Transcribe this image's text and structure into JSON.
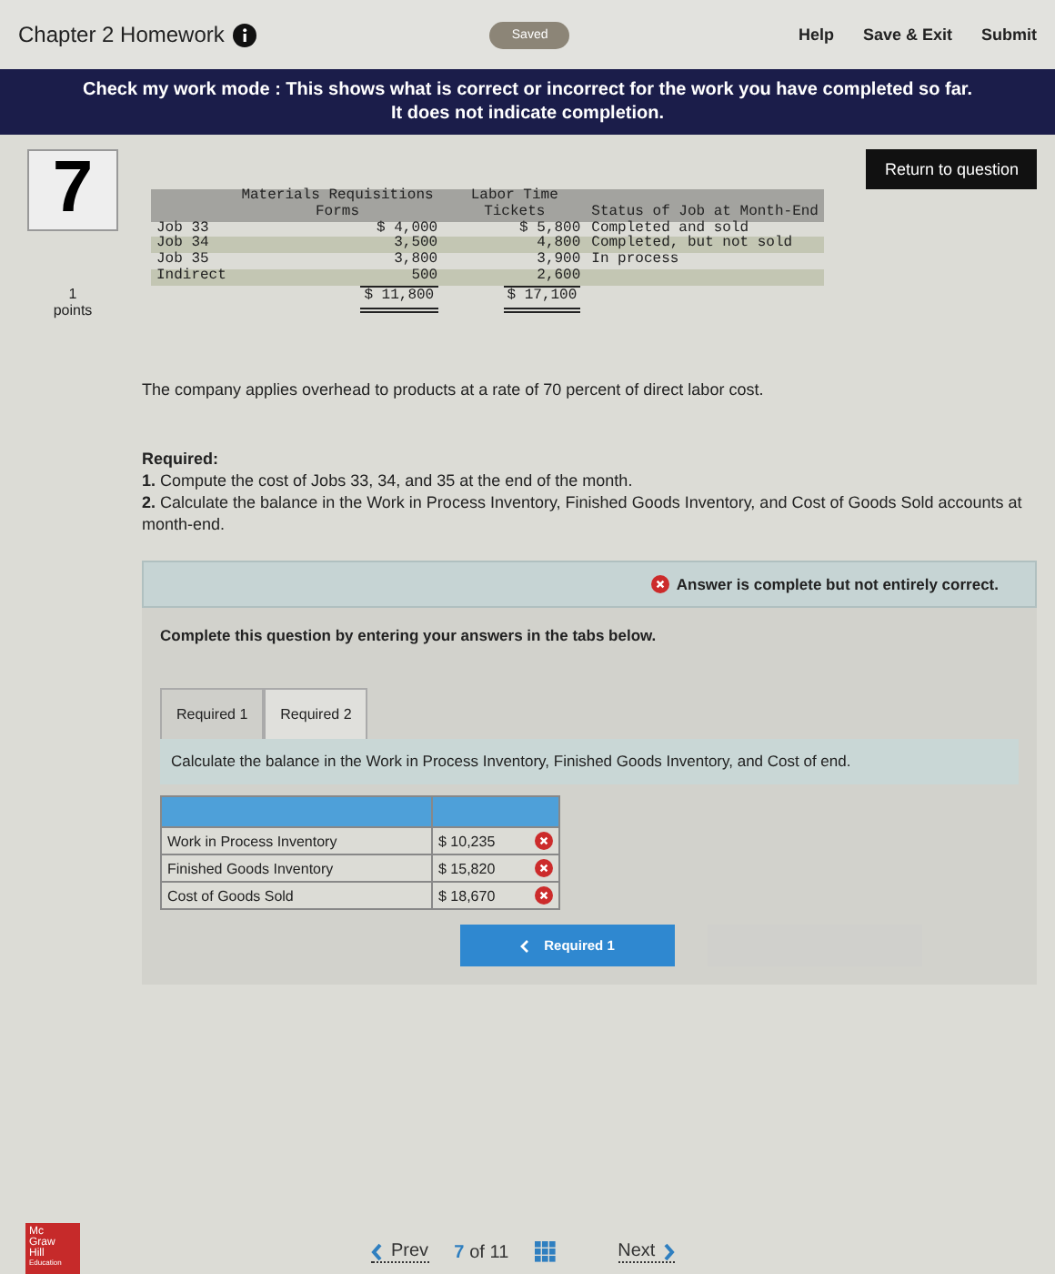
{
  "header": {
    "title": "Chapter 2 Homework",
    "saved_badge": "Saved",
    "links": [
      "Help",
      "Save & Exit",
      "Submit"
    ]
  },
  "banner": {
    "lines": [
      "Check my work mode : This shows what is correct or incorrect for the work you have completed so far.",
      "It does not indicate completion."
    ]
  },
  "return_button": "Return to question",
  "question": {
    "number": "7",
    "points_value": "1",
    "points_label": "points"
  },
  "data_table": {
    "columns": [
      "Materials Requisitions Forms",
      "Labor Time Tickets",
      "Status of Job at Month-End"
    ],
    "rows": [
      {
        "label": "Job 33",
        "materials": "$ 4,000",
        "labor": "$ 5,800",
        "status": "Completed and sold"
      },
      {
        "label": "Job 34",
        "materials": "3,500",
        "labor": "4,800",
        "status": "Completed, but not sold"
      },
      {
        "label": "Job 35",
        "materials": "3,800",
        "labor": "3,900",
        "status": "In process"
      },
      {
        "label": "Indirect",
        "materials": "500",
        "labor": "2,600",
        "status": ""
      }
    ],
    "totals": {
      "materials": "$ 11,800",
      "labor": "$ 17,100"
    }
  },
  "overhead_text": "The company applies overhead to products at a rate of 70 percent of direct labor cost.",
  "required": {
    "heading": "Required:",
    "items": [
      "**1.** Compute the cost of Jobs 33, 34, and 35 at the end of the month.",
      "**2.** Calculate the balance in the Work in Process Inventory, Finished Goods Inventory, and Cost of Goods Sold accounts at month-end."
    ]
  },
  "answer_status": {
    "text": "Answer is complete but not entirely correct.",
    "correct": false
  },
  "instructions": "Complete this question by entering your answers in the tabs below.",
  "tabs": [
    {
      "label": "Required 1",
      "selected": false
    },
    {
      "label": "Required 2",
      "selected": true
    }
  ],
  "tab_prompt": "Calculate the balance in the Work in Process Inventory, Finished Goods Inventory, and Cost of end.",
  "answers": [
    {
      "label": "Work in Process Inventory",
      "value": "$ 10,235",
      "correct": false
    },
    {
      "label": "Finished Goods Inventory",
      "value": "$ 15,820",
      "correct": false
    },
    {
      "label": "Cost of Goods Sold",
      "value": "$ 18,670",
      "correct": false
    }
  ],
  "prev_tab_button": "Required 1",
  "footer": {
    "logo_lines": [
      "Mc",
      "Graw",
      "Hill",
      "Education"
    ],
    "prev": "Prev",
    "page": "7",
    "page_total": "of 11",
    "next": "Next"
  }
}
